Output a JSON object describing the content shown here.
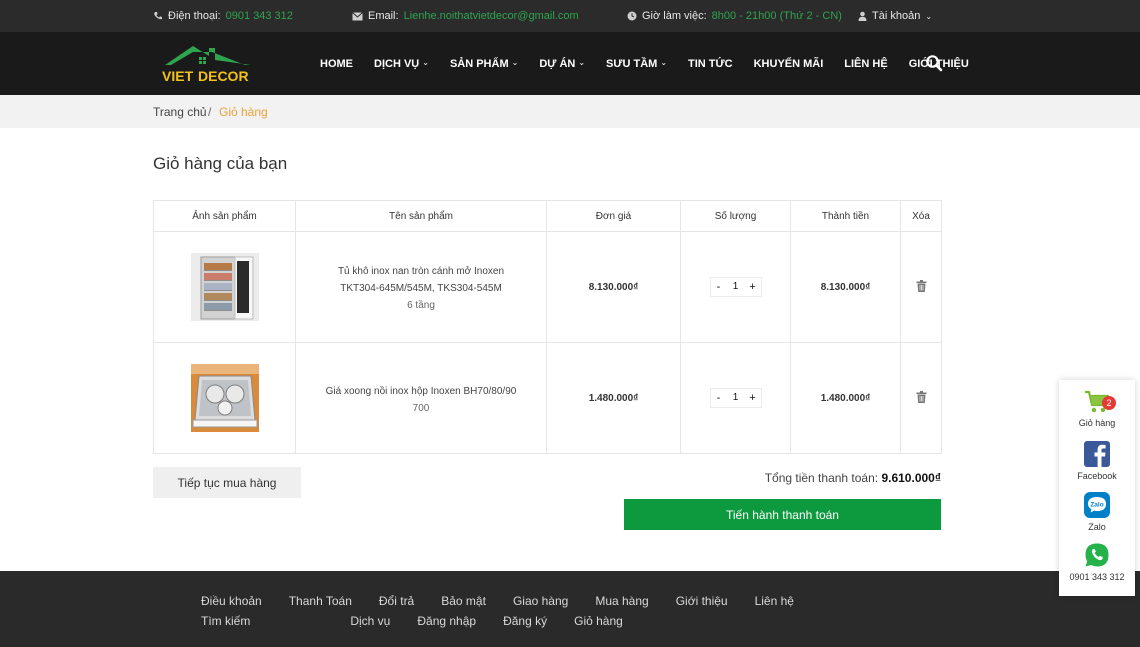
{
  "topbar": {
    "phone_label": "Điện thoại:",
    "phone_value": "0901 343 312",
    "email_label": "Email:",
    "email_value": "Lienhe.noithatvietdecor@gmail.com",
    "hours_label": "Giờ làm việc:",
    "hours_value": "8h00 - 21h00 (Thứ 2 - CN)",
    "account_label": "Tài khoản"
  },
  "logo": {
    "text_1": "VIET",
    "text_2": "DECOR"
  },
  "nav": [
    {
      "label": "HOME",
      "dropdown": false
    },
    {
      "label": "DỊCH VỤ",
      "dropdown": true
    },
    {
      "label": "SẢN PHẨM",
      "dropdown": true
    },
    {
      "label": "DỰ ÁN",
      "dropdown": true
    },
    {
      "label": "SƯU TẦM",
      "dropdown": true
    },
    {
      "label": "TIN TỨC",
      "dropdown": false
    },
    {
      "label": "KHUYẾN MÃI",
      "dropdown": false
    },
    {
      "label": "LIÊN HỆ",
      "dropdown": false
    },
    {
      "label": "GIỚI THIỆU",
      "dropdown": false
    }
  ],
  "breadcrumb": {
    "home": "Trang chủ",
    "separator": "/",
    "current": "Giỏ hàng"
  },
  "page_title": "Giỏ hàng của bạn",
  "cart": {
    "headers": [
      "Ảnh sản phẩm",
      "Tên sản phẩm",
      "Đơn giá",
      "Số lượng",
      "Thành tiền",
      "Xóa"
    ],
    "items": [
      {
        "name": "Tủ khô inox nan tròn cánh mở Inoxen TKT304-645M/545M, TKS304-545M",
        "variant": "6 tầng",
        "unit_price": "8.130.000₫",
        "qty_minus": "-",
        "quantity": "1",
        "qty_plus": "+",
        "line_total": "8.130.000₫"
      },
      {
        "name": "Giá xoong nồi inox hộp Inoxen BH70/80/90",
        "variant": "700",
        "unit_price": "1.480.000₫",
        "qty_minus": "-",
        "quantity": "1",
        "qty_plus": "+",
        "line_total": "1.480.000₫"
      }
    ],
    "continue_label": "Tiếp tục mua hàng",
    "total_label": "Tổng tiền thanh toán:",
    "total_value": "9.610.000₫",
    "checkout_label": "Tiến hành thanh toán"
  },
  "footer": {
    "links": [
      "Điều khoản",
      "Thanh Toán",
      "Đổi trả",
      "Bảo mật",
      "Giao hàng",
      "Mua hàng",
      "Giới thiệu",
      "Liên hệ",
      "Tìm kiếm",
      "Dịch vụ",
      "Đăng nhập",
      "Đăng ký",
      "Giỏ hàng"
    ]
  },
  "side_widget": {
    "cart_label": "Giỏ hàng",
    "cart_count": "2",
    "facebook_label": "Facebook",
    "zalo_label": "Zalo",
    "zalo_icon_text": "Zalo",
    "phone_label": "0901 343 312"
  },
  "colors": {
    "accent_green": "#0d9a3e",
    "topbar_bg": "#2b2b2b",
    "header_bg": "#1a1a1a",
    "breadcrumb_current": "#e8a23a",
    "badge": "#e53935"
  },
  "icons": [
    "phone-icon",
    "mail-icon",
    "clock-icon",
    "user-icon",
    "search-icon",
    "trash-icon",
    "cart-icon",
    "facebook-icon",
    "zalo-icon",
    "whatsapp-icon"
  ]
}
